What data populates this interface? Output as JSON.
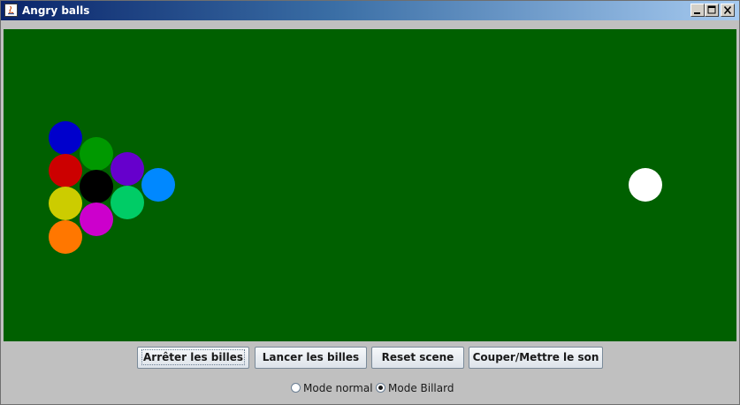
{
  "window": {
    "title": "Angry balls"
  },
  "buttons": {
    "stop": "Arrêter les billes",
    "launch": "Lancer les billes",
    "reset": "Reset scene",
    "sound": "Couper/Mettre le son"
  },
  "modes": {
    "normal": "Mode normal",
    "billard": "Mode Billard",
    "selected": "Mode Billard"
  },
  "table": {
    "felt_color": "#006000",
    "balls": [
      {
        "color": "#0000cc"
      },
      {
        "color": "#cc0000"
      },
      {
        "color": "#cccc00"
      },
      {
        "color": "#ff7700"
      },
      {
        "color": "#009900"
      },
      {
        "color": "#000000"
      },
      {
        "color": "#cc00cc"
      },
      {
        "color": "#6600cc"
      },
      {
        "color": "#00cc66"
      },
      {
        "color": "#0088ff"
      },
      {
        "color": "#ffffff"
      }
    ]
  }
}
